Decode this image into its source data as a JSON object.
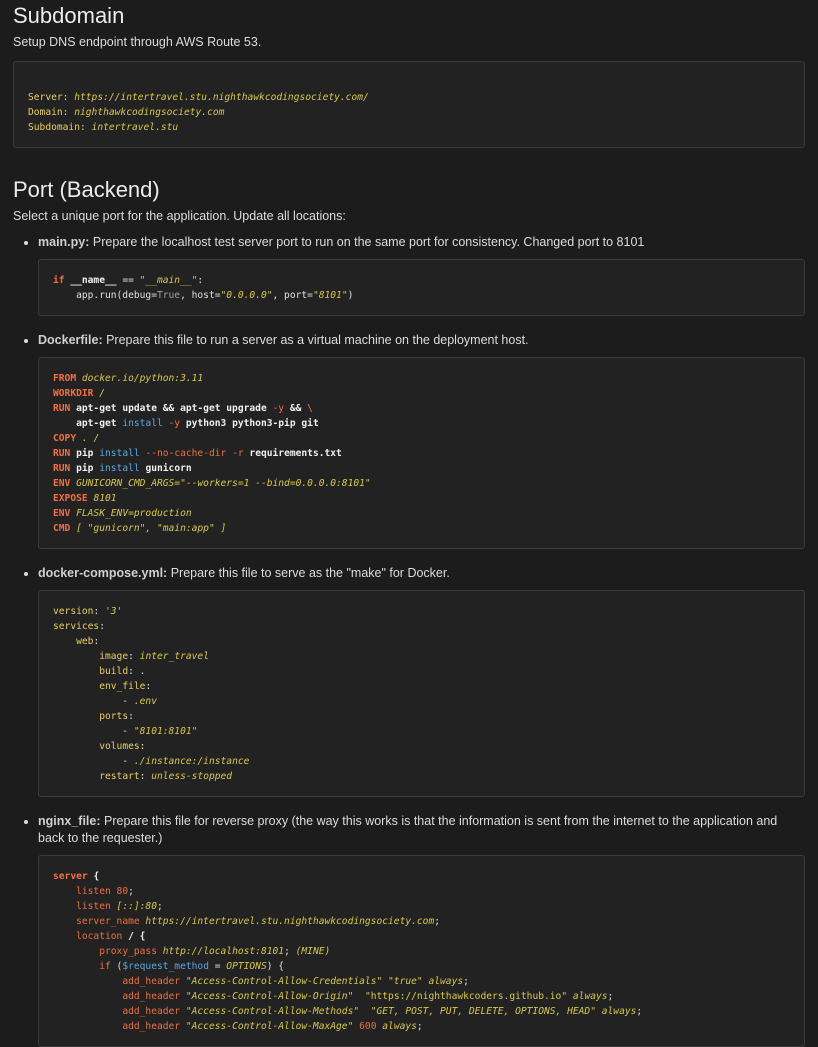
{
  "subdomain": {
    "title": "Subdomain",
    "description": "Setup DNS endpoint through AWS Route 53.",
    "config": [
      {
        "key": "Server:",
        "value": "https://intertravel.stu.nighthawkcodingsociety.com/"
      },
      {
        "key": "Domain:",
        "value": "nighthawkcodingsociety.com"
      },
      {
        "key": "Subdomain:",
        "value": "intertravel.stu"
      }
    ]
  },
  "port": {
    "title": "Port (Backend)",
    "description": "Select a unique port for the application. Update all locations:",
    "items": [
      {
        "name": "main.py:",
        "text": " Prepare the localhost test server port to run on the same port for consistency. Changed port to 8101",
        "code": [
          [
            [
              "k",
              "if "
            ],
            [
              "b",
              "__name__"
            ],
            [
              "t",
              " == "
            ],
            [
              "s",
              "\"__main__\""
            ],
            [
              "t",
              ":"
            ]
          ],
          [
            [
              "t",
              "    app.run(debug="
            ],
            [
              "g",
              "True"
            ],
            [
              "t",
              ", host="
            ],
            [
              "s",
              "\"0.0.0.0\""
            ],
            [
              "t",
              ", port="
            ],
            [
              "s",
              "\"8101\""
            ],
            [
              "t",
              ")"
            ]
          ]
        ]
      },
      {
        "name": "Dockerfile:",
        "text": " Prepare this file to run a server as a virtual machine on the deployment host.",
        "code": [
          [
            [
              "k",
              "FROM "
            ],
            [
              "s",
              "docker.io/python:3.11"
            ]
          ],
          [
            [
              "k",
              "WORKDIR "
            ],
            [
              "s",
              "/"
            ]
          ],
          [
            [
              "k",
              "RUN "
            ],
            [
              "b",
              "apt-get update && apt-get upgrade "
            ],
            [
              "kn",
              "-y"
            ],
            [
              "b",
              " && "
            ],
            [
              "kn",
              "\\"
            ]
          ],
          [
            [
              "b",
              "    apt-get "
            ],
            [
              "c",
              "install "
            ],
            [
              "kn",
              "-y"
            ],
            [
              "b",
              " python3 python3-pip git"
            ]
          ],
          [
            [
              "k",
              "COPY "
            ],
            [
              "s",
              ". /"
            ]
          ],
          [
            [
              "k",
              "RUN "
            ],
            [
              "b",
              "pip "
            ],
            [
              "c",
              "install "
            ],
            [
              "kn",
              "--no-cache-dir -r"
            ],
            [
              "b",
              " requirements.txt"
            ]
          ],
          [
            [
              "k",
              "RUN "
            ],
            [
              "b",
              "pip "
            ],
            [
              "c",
              "install "
            ],
            [
              "b",
              "gunicorn"
            ]
          ],
          [
            [
              "k",
              "ENV "
            ],
            [
              "s",
              "GUNICORN_CMD_ARGS=\"--workers=1 --bind=0.0.0.0:8101\""
            ]
          ],
          [
            [
              "k",
              "EXPOSE "
            ],
            [
              "s",
              "8101"
            ]
          ],
          [
            [
              "k",
              "ENV "
            ],
            [
              "s",
              "FLASK_ENV=production"
            ]
          ],
          [
            [
              "k",
              "CMD "
            ],
            [
              "s",
              "[ \"gunicorn\", \"main:app\" ]"
            ]
          ]
        ]
      },
      {
        "name": "docker-compose.yml:",
        "text": " Prepare this file to serve as the \"make\" for Docker.",
        "code": [
          [
            [
              "y",
              "version"
            ],
            [
              "t",
              ": "
            ],
            [
              "s",
              "'3'"
            ]
          ],
          [
            [
              "y",
              "services"
            ],
            [
              "t",
              ":"
            ]
          ],
          [
            [
              "t",
              "    "
            ],
            [
              "y",
              "web"
            ],
            [
              "t",
              ":"
            ]
          ],
          [
            [
              "t",
              "        "
            ],
            [
              "y",
              "image"
            ],
            [
              "t",
              ": "
            ],
            [
              "s",
              "inter_travel"
            ]
          ],
          [
            [
              "t",
              "        "
            ],
            [
              "y",
              "build"
            ],
            [
              "t",
              ": ."
            ]
          ],
          [
            [
              "t",
              "        "
            ],
            [
              "y",
              "env_file"
            ],
            [
              "t",
              ":"
            ]
          ],
          [
            [
              "t",
              "            - "
            ],
            [
              "s",
              ".env"
            ]
          ],
          [
            [
              "t",
              "        "
            ],
            [
              "y",
              "ports"
            ],
            [
              "t",
              ":"
            ]
          ],
          [
            [
              "t",
              "            - "
            ],
            [
              "s",
              "\"8101:8101\""
            ]
          ],
          [
            [
              "t",
              "        "
            ],
            [
              "y",
              "volumes"
            ],
            [
              "t",
              ":"
            ]
          ],
          [
            [
              "t",
              "            - "
            ],
            [
              "s",
              "./instance:/instance"
            ]
          ],
          [
            [
              "t",
              "        "
            ],
            [
              "y",
              "restart"
            ],
            [
              "t",
              ": "
            ],
            [
              "s",
              "unless-stopped"
            ]
          ]
        ]
      },
      {
        "name": "nginx_file:",
        "text": " Prepare this file for reverse proxy (the way this works is that the information is sent from the internet to the application and back to the requester.)",
        "code": [
          [
            [
              "k",
              "server "
            ],
            [
              "b",
              "{"
            ]
          ],
          [
            [
              "t",
              "    "
            ],
            [
              "kn",
              "listen "
            ],
            [
              "n",
              "80"
            ],
            [
              "t",
              ";"
            ]
          ],
          [
            [
              "t",
              "    "
            ],
            [
              "kn",
              "listen "
            ],
            [
              "s",
              "[::]:80"
            ],
            [
              "t",
              ";"
            ]
          ],
          [
            [
              "t",
              "    "
            ],
            [
              "kn",
              "server_name "
            ],
            [
              "s",
              "https://intertravel.stu.nighthawkcodingsociety.com"
            ],
            [
              "t",
              ";"
            ]
          ],
          [
            [
              "t",
              "    "
            ],
            [
              "kn",
              "location "
            ],
            [
              "b",
              "/ {"
            ]
          ],
          [
            [
              "t",
              "        "
            ],
            [
              "kn",
              "proxy_pass "
            ],
            [
              "s",
              "http://localhost:8101"
            ],
            [
              "t",
              "; "
            ],
            [
              "s",
              "(MINE)"
            ]
          ],
          [
            [
              "t",
              "        "
            ],
            [
              "kn",
              "if "
            ],
            [
              "t",
              "("
            ],
            [
              "c",
              "$request_method"
            ],
            [
              "t",
              " = "
            ],
            [
              "s",
              "OPTIONS"
            ],
            [
              "t",
              ") {"
            ]
          ],
          [
            [
              "t",
              "            "
            ],
            [
              "kn",
              "add_header "
            ],
            [
              "s",
              "\"Access-Control-Allow-Credentials\""
            ],
            [
              "t",
              " "
            ],
            [
              "s",
              "\"true\""
            ],
            [
              "t",
              " "
            ],
            [
              "s",
              "always"
            ],
            [
              "t",
              ";"
            ]
          ],
          [
            [
              "t",
              "            "
            ],
            [
              "kn",
              "add_header "
            ],
            [
              "s",
              "\"Access-Control-Allow-Origin\""
            ],
            [
              "t",
              "  "
            ],
            [
              "sn",
              "\"https://nighthawkcoders.github.io\""
            ],
            [
              "t",
              " "
            ],
            [
              "s",
              "always"
            ],
            [
              "t",
              ";"
            ]
          ],
          [
            [
              "t",
              "            "
            ],
            [
              "kn",
              "add_header "
            ],
            [
              "s",
              "\"Access-Control-Allow-Methods\""
            ],
            [
              "t",
              "  "
            ],
            [
              "s",
              "\"GET, POST, PUT, DELETE, OPTIONS, HEAD\""
            ],
            [
              "t",
              " "
            ],
            [
              "s",
              "always"
            ],
            [
              "t",
              ";"
            ]
          ],
          [
            [
              "t",
              "            "
            ],
            [
              "kn",
              "add_header "
            ],
            [
              "s",
              "\"Access-Control-Allow-MaxAge\""
            ],
            [
              "t",
              " "
            ],
            [
              "n",
              "600"
            ],
            [
              "t",
              " "
            ],
            [
              "s",
              "always"
            ],
            [
              "t",
              ";"
            ]
          ]
        ]
      }
    ]
  }
}
